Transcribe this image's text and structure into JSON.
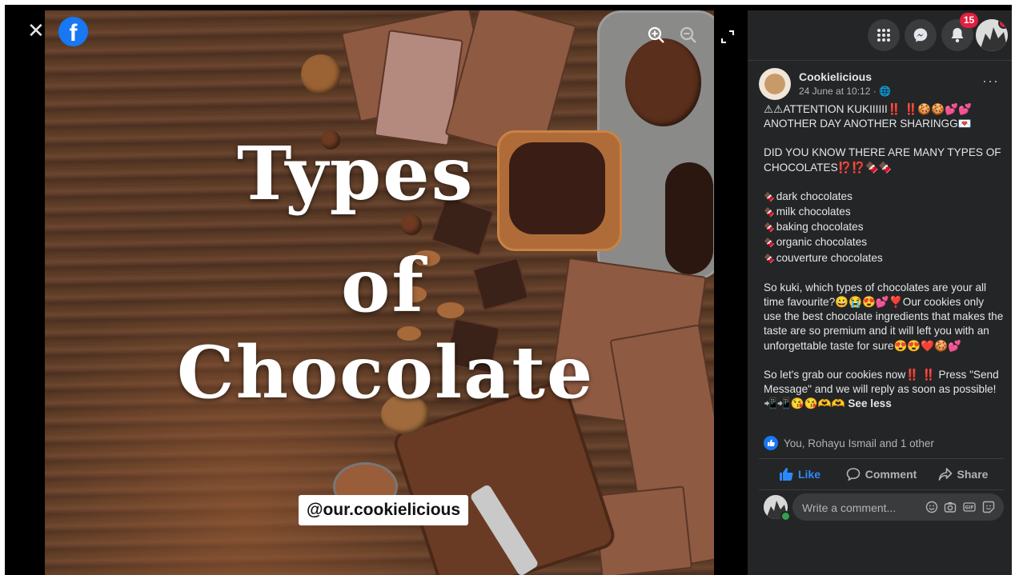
{
  "viewer": {
    "close_glyph": "✕",
    "logo_letter": "f"
  },
  "photo": {
    "title_line1": "Types",
    "title_line2": "of",
    "title_line3": "Chocolate",
    "handle": "@our.cookielicious"
  },
  "topbar": {
    "notifications_count": "15"
  },
  "post": {
    "page_name": "Cookielicious",
    "date": "24 June at 10:12 · 🌐",
    "more_glyph": "···",
    "line1": "⚠⚠ATTENTION KUKIIIIII‼️ ‼️🍪🍪💕💕",
    "line2": "ANOTHER DAY ANOTHER SHARINGG💌",
    "line3": "DID YOU KNOW THERE ARE MANY TYPES OF CHOCOLATES⁉️⁉️🍫🍫",
    "types": [
      "dark chocolates",
      "milk chocolates",
      "baking chocolates",
      "organic chocolates",
      "couverture chocolates"
    ],
    "bullet": "🍫",
    "para2": "So kuki, which types of chocolates are your all time favourite?😀😭😍💕❣️Our cookies only use the best chocolate ingredients that makes the taste are so premium and it will left you with an unforgettable taste for sure😍😍❤️🍪💕",
    "para3": "So let's grab our cookies now‼️ ‼️ Press \"Send Message\" and we will reply as soon as possible!",
    "para3_emoji": "📲📲😘😘🫶🫶",
    "see_less": "See less"
  },
  "reactions": {
    "text": "You, Rohayu Ismail and 1 other"
  },
  "actions": {
    "like": "Like",
    "comment": "Comment",
    "share": "Share"
  },
  "comment": {
    "placeholder": "Write a comment..."
  }
}
